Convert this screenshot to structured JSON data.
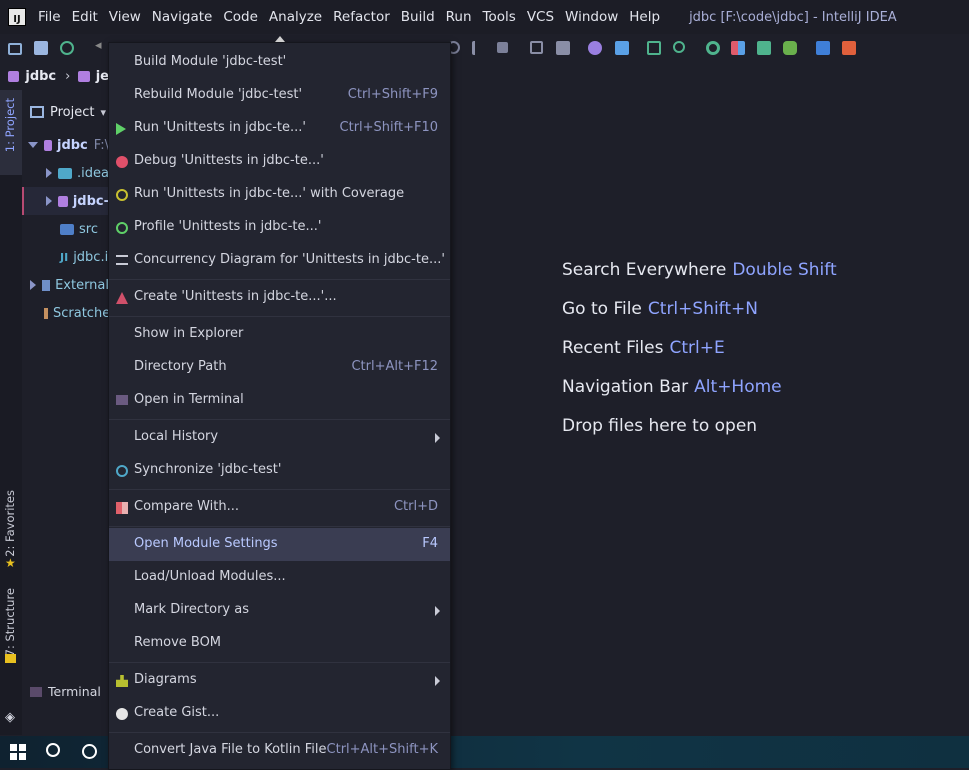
{
  "menubar": {
    "logo_text": "IJ",
    "items": [
      "File",
      "Edit",
      "View",
      "Navigate",
      "Code",
      "Analyze",
      "Refactor",
      "Build",
      "Run",
      "Tools",
      "VCS",
      "Window",
      "Help"
    ],
    "window_title": "jdbc [F:\\code\\jdbc] - IntelliJ IDEA"
  },
  "breadcrumb": {
    "root": "jdbc",
    "next": "je"
  },
  "left_stripe": {
    "project": "1: Project",
    "favorites": "2: Favorites",
    "structure": "7: Structure"
  },
  "project_panel": {
    "title": "Project",
    "rows": [
      {
        "label": "jdbc",
        "extra": "F:\\"
      },
      {
        "label": ".idea"
      },
      {
        "label": "jdbc-"
      },
      {
        "label": "src"
      },
      {
        "label": "jdbc.i"
      },
      {
        "label": "External"
      },
      {
        "label": "Scratche"
      }
    ]
  },
  "terminal_tab": "Terminal",
  "context_menu": {
    "items": [
      {
        "label": "Build Module 'jdbc-test'",
        "shortcut": "",
        "icon": "none"
      },
      {
        "label": "Rebuild Module 'jdbc-test'",
        "shortcut": "Ctrl+Shift+F9",
        "icon": "none"
      },
      {
        "label": "Run 'Unittests in jdbc-te...'",
        "shortcut": "Ctrl+Shift+F10",
        "icon": "run-icon"
      },
      {
        "label": "Debug 'Unittests in jdbc-te...'",
        "shortcut": "",
        "icon": "debug-icon"
      },
      {
        "label": "Run 'Unittests in jdbc-te...' with Coverage",
        "shortcut": "",
        "icon": "coverage-icon"
      },
      {
        "label": "Profile 'Unittests in jdbc-te...'",
        "shortcut": "",
        "icon": "profile-icon"
      },
      {
        "label": "Concurrency Diagram for 'Unittests in jdbc-te...'",
        "shortcut": "",
        "icon": "concurrency-icon"
      },
      {
        "label": "Create 'Unittests in jdbc-te...'...",
        "shortcut": "",
        "icon": "create-config-icon"
      },
      {
        "label": "Show in Explorer",
        "shortcut": "",
        "icon": "none"
      },
      {
        "label": "Directory Path",
        "shortcut": "Ctrl+Alt+F12",
        "icon": "none"
      },
      {
        "label": "Open in Terminal",
        "shortcut": "",
        "icon": "terminal-icon"
      },
      {
        "label": "Local History",
        "shortcut": "",
        "icon": "none"
      },
      {
        "label": "Synchronize 'jdbc-test'",
        "shortcut": "",
        "icon": "sync-icon"
      },
      {
        "label": "Compare With...",
        "shortcut": "Ctrl+D",
        "icon": "compare-icon"
      },
      {
        "label": "Open Module Settings",
        "shortcut": "F4",
        "icon": "none"
      },
      {
        "label": "Load/Unload Modules...",
        "shortcut": "",
        "icon": "none"
      },
      {
        "label": "Mark Directory as",
        "shortcut": "",
        "icon": "none"
      },
      {
        "label": "Remove BOM",
        "shortcut": "",
        "icon": "none"
      },
      {
        "label": "Diagrams",
        "shortcut": "",
        "icon": "diagrams-icon"
      },
      {
        "label": "Create Gist...",
        "shortcut": "",
        "icon": "github-icon"
      },
      {
        "label": "Convert Java File to Kotlin File",
        "shortcut": "Ctrl+Alt+Shift+K",
        "icon": "none"
      }
    ]
  },
  "welcome": {
    "hints": [
      {
        "text": "Search Everywhere",
        "key": "Double Shift"
      },
      {
        "text": "Go to File",
        "key": "Ctrl+Shift+N"
      },
      {
        "text": "Recent Files",
        "key": "Ctrl+E"
      },
      {
        "text": "Navigation Bar",
        "key": "Alt+Home"
      },
      {
        "text": "Drop files here to open",
        "key": ""
      }
    ]
  },
  "colors": {
    "accent": "#8fa4ff",
    "selection": "#3a3d52",
    "background": "#1e1f29"
  }
}
